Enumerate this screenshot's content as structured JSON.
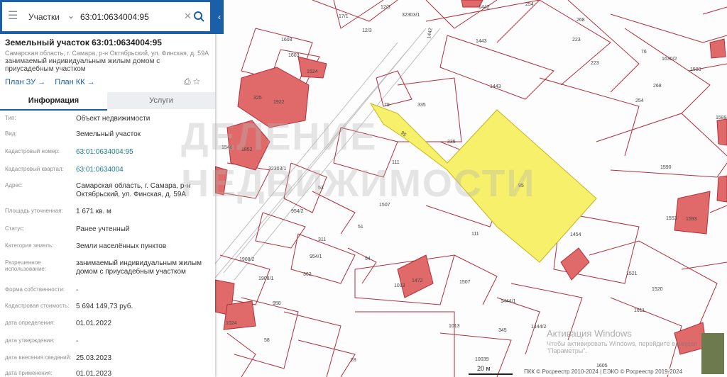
{
  "search": {
    "layer": "Участки",
    "value": "63:01:0634004:95"
  },
  "object": {
    "title": "Земельный участок 63:01:0634004:95",
    "address": "Самарская область, г. Самара, р-н Октябрьский, ул. Финская, д. 59А",
    "usage": "занимаемый индивидуальным жилым домом с приусадебным участком",
    "plan_zu": "План ЗУ →",
    "plan_kk": "План КК →"
  },
  "tabs": [
    "Информация",
    "Услуги"
  ],
  "info": [
    {
      "label": "Тип:",
      "value": "Объект недвижимости"
    },
    {
      "label": "Вид:",
      "value": "Земельный участок"
    },
    {
      "label": "Кадастровый номер:",
      "value": "63:01:0634004:95"
    },
    {
      "label": "Кадастровый квартал:",
      "value": "63:01:0634004"
    },
    {
      "label": "Адрес:",
      "value": "Самарская область, г. Самара, р-н Октябрьский, ул. Финская, д. 59А"
    },
    {
      "label": "Площадь уточненная:",
      "value": "1 671 кв. м"
    },
    {
      "label": "Статус:",
      "value": "Ранее учтенный"
    },
    {
      "label": "Категория земель:",
      "value": "Земли населённых пунктов"
    },
    {
      "label": "Разрешенное использование:",
      "value": "занимаемый индивидуальным жилым домом с приусадебным участком"
    },
    {
      "label": "Форма собственности:",
      "value": "-"
    },
    {
      "label": "Кадастровая стоимость:",
      "value": "5 694 149,73 руб."
    },
    {
      "label": "дата определения:",
      "value": "01.01.2022"
    },
    {
      "label": "дата утверждения:",
      "value": "-"
    },
    {
      "label": "дата внесения сведений:",
      "value": "25.03.2023"
    },
    {
      "label": "дата применения:",
      "value": "01.01.2023"
    }
  ],
  "map": {
    "labels": [
      "17/1",
      "12/3",
      "12/3",
      "32303/1",
      "1442",
      "254",
      "268",
      "1603",
      "1603",
      "1442",
      "1443",
      "223",
      "76",
      "1630/2",
      "1580",
      "1524",
      "325",
      "1922",
      "1443",
      "223",
      "268",
      "254",
      "79",
      "335",
      "1589",
      "1546",
      "1852",
      "335",
      "111",
      "32303/1",
      "1590",
      "95",
      "53",
      "954/2",
      "1507",
      "1553",
      "1593",
      "311",
      "51",
      "1454",
      "954/1",
      "54",
      "111",
      "1908/2",
      "362",
      "1013",
      "1472",
      "1507",
      "1521",
      "1908/1",
      "1444/1",
      "1520",
      "958",
      "1444/2",
      "1024",
      "1013",
      "345",
      "1611",
      "58",
      "28",
      "10039",
      "1605",
      "95"
    ],
    "scale": "20 м",
    "attribution": "ПКК © Росреестр 2010-2024 | ЕЭКО © Росреестр 2019-2024",
    "activate_title": "Активация Windows",
    "activate_sub": "Чтобы активировать Windows, перейдите в раздел \"Параметры\"."
  },
  "watermark": "ДЕЛЕНИЕ НЕДВИЖИМОСТИ",
  "colors": {
    "accent": "#1a5fa8",
    "parcel_line": "#b32e3b",
    "highlight": "#f6f06a",
    "building": "#e06a6a"
  }
}
